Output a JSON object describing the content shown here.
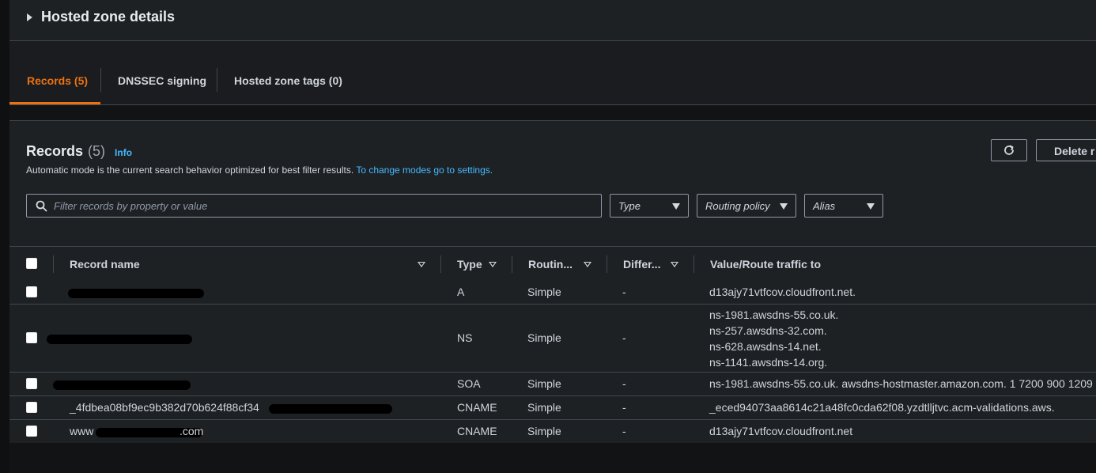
{
  "hosted_zone": {
    "title": "Hosted zone details"
  },
  "tabs": [
    {
      "label": "Records (5)",
      "active": true
    },
    {
      "label": "DNSSEC signing",
      "active": false
    },
    {
      "label": "Hosted zone tags (0)",
      "active": false
    }
  ],
  "records_panel": {
    "title": "Records",
    "count": "(5)",
    "info": "Info",
    "description": "Automatic mode is the current search behavior optimized for best filter results.",
    "settings_link": "To change modes go to settings.",
    "refresh_icon": "refresh-icon",
    "delete_label": "Delete r"
  },
  "filter": {
    "placeholder": "Filter records by property or value",
    "type_label": "Type",
    "routing_label": "Routing policy",
    "alias_label": "Alias"
  },
  "columns": [
    {
      "label": "Record name"
    },
    {
      "label": "Type"
    },
    {
      "label": "Routin..."
    },
    {
      "label": "Differ..."
    },
    {
      "label": "Value/Route traffic to"
    }
  ],
  "rows": [
    {
      "name": "",
      "type": "A",
      "routing": "Simple",
      "differ": "-",
      "value": [
        "d13ajy71vtfcov.cloudfront.net."
      ]
    },
    {
      "name": "",
      "type": "NS",
      "routing": "Simple",
      "differ": "-",
      "value": [
        "ns-1981.awsdns-55.co.uk.",
        "ns-257.awsdns-32.com.",
        "ns-628.awsdns-14.net.",
        "ns-1141.awsdns-14.org."
      ]
    },
    {
      "name": "",
      "type": "SOA",
      "routing": "Simple",
      "differ": "-",
      "value": [
        "ns-1981.awsdns-55.co.uk. awsdns-hostmaster.amazon.com. 1 7200 900 1209"
      ]
    },
    {
      "name": "_4fdbea08bf9ec9b382d70b624f88cf34",
      "type": "CNAME",
      "routing": "Simple",
      "differ": "-",
      "value": [
        "_eced94073aa8614c21a48fc0cda62f08.yzdtlljtvc.acm-validations.aws."
      ]
    },
    {
      "name": "www",
      "name_suffix": ".com",
      "type": "CNAME",
      "routing": "Simple",
      "differ": "-",
      "value": [
        "d13ajy71vtfcov.cloudfront.net"
      ]
    }
  ],
  "colors": {
    "accent": "#ec7211",
    "link": "#44b9ff",
    "background": "#1e2124",
    "border": "#414750"
  }
}
